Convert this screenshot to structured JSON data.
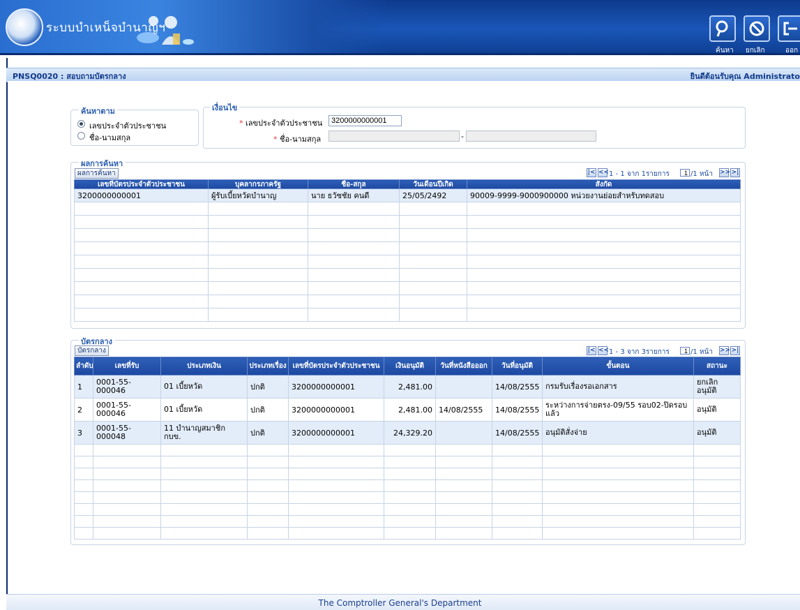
{
  "header": {
    "app_title": "ระบบบำเหน็จบำนาญฯ",
    "toolbar": [
      {
        "name": "search",
        "label": "ค้นหา"
      },
      {
        "name": "cancel",
        "label": "ยกเลิก"
      },
      {
        "name": "exit",
        "label": "ออก"
      }
    ]
  },
  "titlebar": {
    "page_code": "PNSQ0020 : สอบถามบัตรกลาง",
    "welcome": "ยินดีต้อนรับคุณ Administrato"
  },
  "search_by": {
    "legend": "ค้นหาตาม",
    "options": [
      "เลขประจำตัวประชาชน",
      "ชื่อ-นามสกุล"
    ],
    "selected_index": 0
  },
  "condition": {
    "legend": "เงื่อนไข",
    "id_label": "เลขประจำตัวประชาชน",
    "id_value": "3200000000001",
    "name_label": "ชื่อ-นามสกุล",
    "name_first": "",
    "name_separator": "-",
    "name_last": ""
  },
  "results": {
    "legend": "ผลการค้นหา",
    "tab_label": "ผลการค้นหา",
    "pager": {
      "text": "1 - 1 จาก 1รายการ",
      "page": "1",
      "total": "/1 หน้า"
    },
    "columns": [
      "เลขที่บัตรประจำตัวประชาชน",
      "บุคลากรภาครัฐ",
      "ชื่อ-สกุล",
      "วันเดือนปีเกิด",
      "สังกัด"
    ],
    "rows": [
      [
        "3200000000001",
        "ผู้รับเบี้ยหวัดบำนาญ",
        "นาย ธวัชชัย คนดี",
        "25/05/2492",
        "90009-9999-9000900000 หน่วยงานย่อยสำหรับทดสอบ"
      ]
    ],
    "empty_rows": 9
  },
  "central_card": {
    "legend": "บัตรกลาง",
    "tab_label": "บัตรกลาง",
    "pager": {
      "text": "1 - 3 จาก 3รายการ",
      "page": "1",
      "total": "/1 หน้า"
    },
    "columns": [
      "ลำดับ",
      "เลขที่รับ",
      "ประเภทเงิน",
      "ประเภทเรื่อง",
      "เลขที่บัตรประจำตัวประชาชน",
      "เงินอนุมัติ",
      "วันที่หนังสือออก",
      "วันที่อนุมัติ",
      "ขั้นตอน",
      "สถานะ"
    ],
    "rows": [
      [
        "1",
        "0001-55-000046",
        "01 เบี้ยหวัด",
        "ปกติ",
        "3200000000001",
        "2,481.00",
        "",
        "14/08/2555",
        "กรมรับเรื่องรอเอกสาร",
        "ยกเลิกอนุมัติ"
      ],
      [
        "2",
        "0001-55-000046",
        "01 เบี้ยหวัด",
        "ปกติ",
        "3200000000001",
        "2,481.00",
        "14/08/2555",
        "14/08/2555",
        "ระหว่างการจ่ายตรง-09/55 รอบ02-ปิดรอบแล้ว",
        "อนุมัติ"
      ],
      [
        "3",
        "0001-55-000048",
        "11 บำนาญสมาชิก กบข.",
        "ปกติ",
        "3200000000001",
        "24,329.20",
        "",
        "14/08/2555",
        "อนุมัติสั่งจ่าย",
        "อนุมัติ"
      ]
    ],
    "empty_rows": 8
  },
  "footer": {
    "text": "The Comptroller General's Department"
  }
}
